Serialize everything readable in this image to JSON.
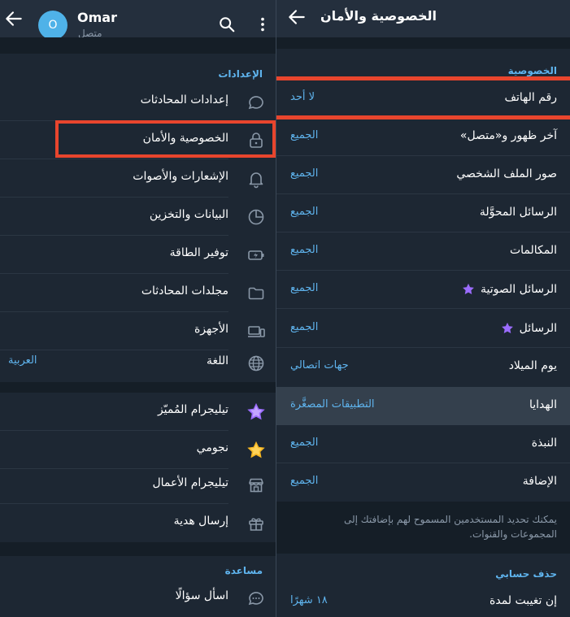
{
  "left": {
    "header": {
      "avatar_letter": "O",
      "name": "Omar",
      "status": "متصل"
    },
    "settings_title": "الإعدادات",
    "items": [
      {
        "label": "إعدادات المحادثات",
        "icon": "chat-bubble-icon"
      },
      {
        "label": "الخصوصية والأمان",
        "icon": "lock-icon"
      },
      {
        "label": "الإشعارات والأصوات",
        "icon": "bell-icon"
      },
      {
        "label": "البيانات والتخزين",
        "icon": "pie-chart-icon"
      },
      {
        "label": "توفير الطاقة",
        "icon": "battery-icon"
      },
      {
        "label": "مجلدات المحادثات",
        "icon": "folder-icon"
      },
      {
        "label": "الأجهزة",
        "icon": "devices-icon"
      },
      {
        "label": "اللغة",
        "value": "العربية",
        "icon": "globe-icon"
      }
    ],
    "extras": [
      {
        "label": "تيليجرام المُميّز",
        "icon": "premium-star-icon"
      },
      {
        "label": "نجومي",
        "icon": "gold-star-icon"
      },
      {
        "label": "تيليجرام الأعمال",
        "icon": "shop-icon"
      },
      {
        "label": "إرسال هدية",
        "icon": "gift-icon"
      }
    ],
    "help_title": "مساعدة",
    "help_items": [
      {
        "label": "اسأل سؤالًا",
        "icon": "question-chat-icon"
      }
    ]
  },
  "right": {
    "header": {
      "title": "الخصوصية والأمان"
    },
    "privacy_title": "الخصوصية",
    "rows": [
      {
        "label": "رقم الهاتف",
        "value": "لا أحد"
      },
      {
        "label": "آخر ظهور و«متصل»",
        "value": "الجميع"
      },
      {
        "label": "صور الملف الشخصي",
        "value": "الجميع"
      },
      {
        "label": "الرسائل المحوَّلة",
        "value": "الجميع"
      },
      {
        "label": "المكالمات",
        "value": "الجميع"
      },
      {
        "label": "الرسائل الصوتية",
        "value": "الجميع",
        "star": true
      },
      {
        "label": "الرسائل",
        "value": "الجميع",
        "star": true
      },
      {
        "label": "يوم الميلاد",
        "value": "جهات اتصالي"
      },
      {
        "label": "الهدايا",
        "value": "التطبيقات المصغَّرة"
      },
      {
        "label": "النبذة",
        "value": "الجميع"
      },
      {
        "label": "الإضافة",
        "value": "الجميع"
      }
    ],
    "hint": "يمكنك تحديد المستخدمين المسموح لهم بإضافتك إلى المجموعات والقنوات.",
    "delete_title": "حذف حسابي",
    "delete_row": {
      "label": "إن تغيبت لمدة",
      "value": "١٨ شهرًا"
    }
  },
  "colors": {
    "accent": "#5fb4ee",
    "highlight": "#e8452d",
    "premium_star": "#9b6cff",
    "background": "#1d2733"
  }
}
